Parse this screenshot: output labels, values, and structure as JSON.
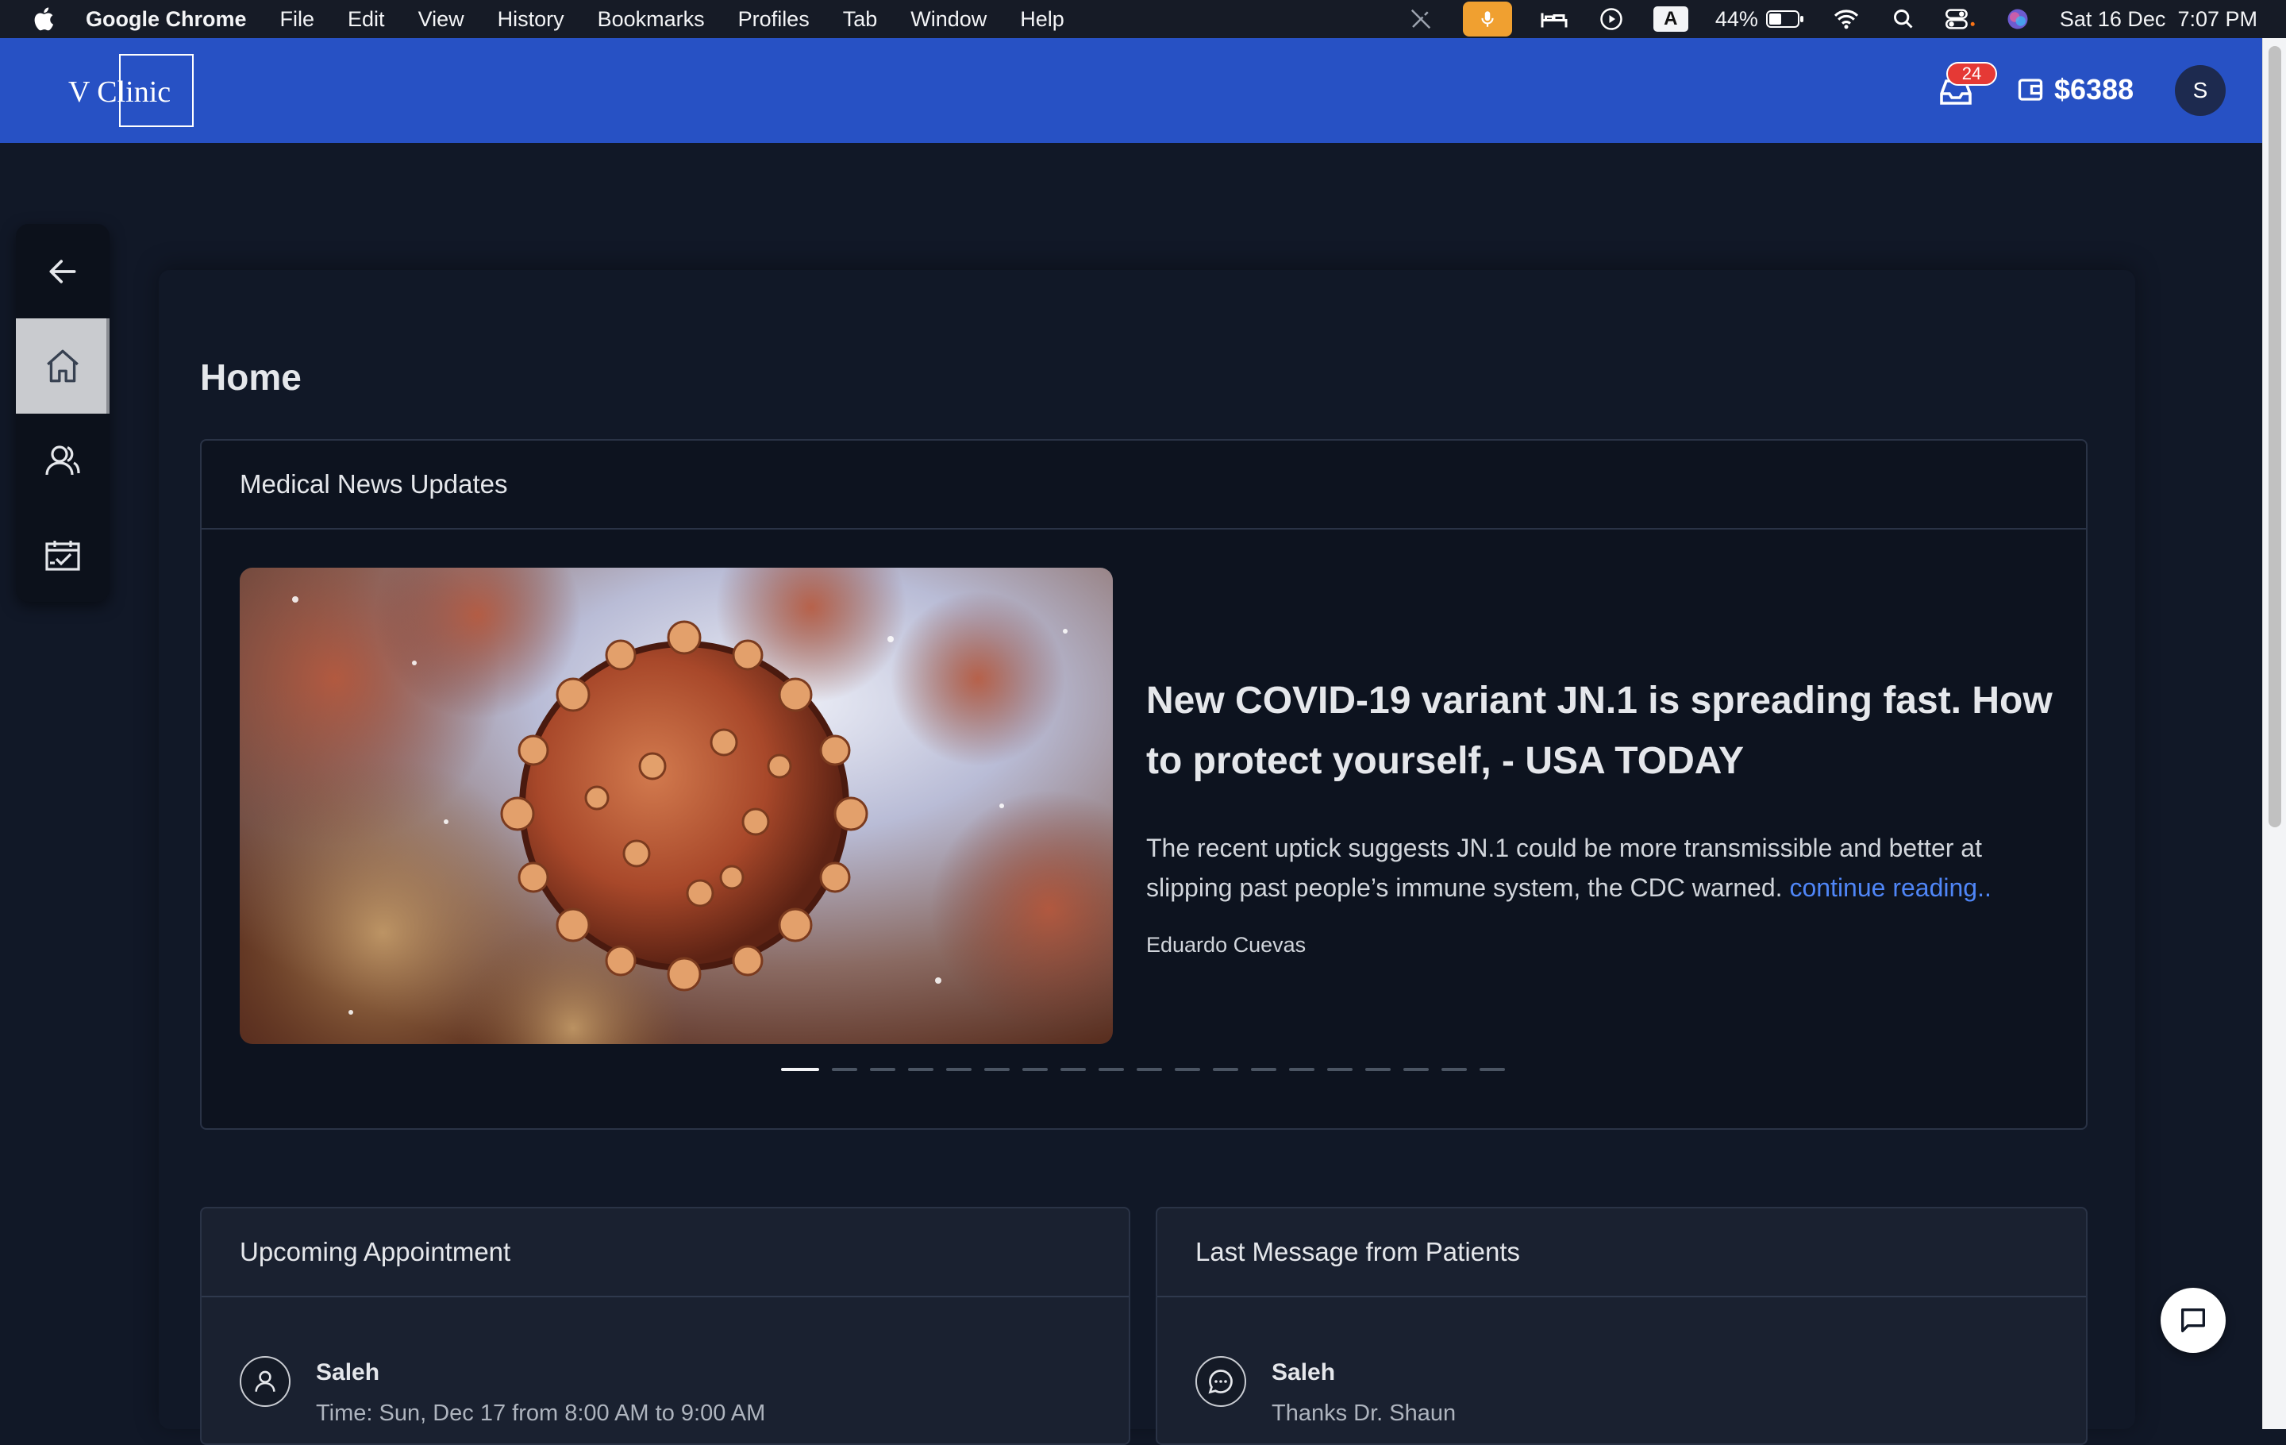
{
  "menubar": {
    "app_name": "Google Chrome",
    "items": [
      "File",
      "Edit",
      "View",
      "History",
      "Bookmarks",
      "Profiles",
      "Tab",
      "Window",
      "Help"
    ],
    "battery_percent": "44%",
    "datetime": "Sat 16 Dec  7:07 PM",
    "input_indicator": "A"
  },
  "header": {
    "logo_text": "V Clinic",
    "notification_count": "24",
    "wallet_amount": "$6388",
    "avatar_initial": "S"
  },
  "sidebar": {
    "items": [
      {
        "name": "back",
        "icon": "arrow-left-icon"
      },
      {
        "name": "home",
        "icon": "home-icon",
        "active": true
      },
      {
        "name": "patients",
        "icon": "users-icon"
      },
      {
        "name": "appointments",
        "icon": "calendar-check-icon"
      }
    ]
  },
  "page": {
    "title": "Home"
  },
  "news": {
    "heading": "Medical News Updates",
    "title": "New COVID-19 variant JN.1 is spreading fast. How to protect yourself, - USA TODAY",
    "description": "The recent uptick suggests JN.1 could be more transmissible and better at slipping past people’s immune system, the CDC warned.",
    "link_text": "continue reading..",
    "author": "Eduardo Cuevas",
    "slide_count": 19,
    "active_slide": 0
  },
  "appointment": {
    "heading": "Upcoming Appointment",
    "name": "Saleh",
    "time": "Time: Sun, Dec 17 from 8:00 AM to 9:00 AM"
  },
  "messages": {
    "heading": "Last Message from Patients",
    "name": "Saleh",
    "text": "Thanks Dr. Shaun"
  },
  "colors": {
    "header_bg": "#2751c4",
    "page_bg": "#111827",
    "link": "#4f86f7",
    "badge": "#e53935"
  }
}
